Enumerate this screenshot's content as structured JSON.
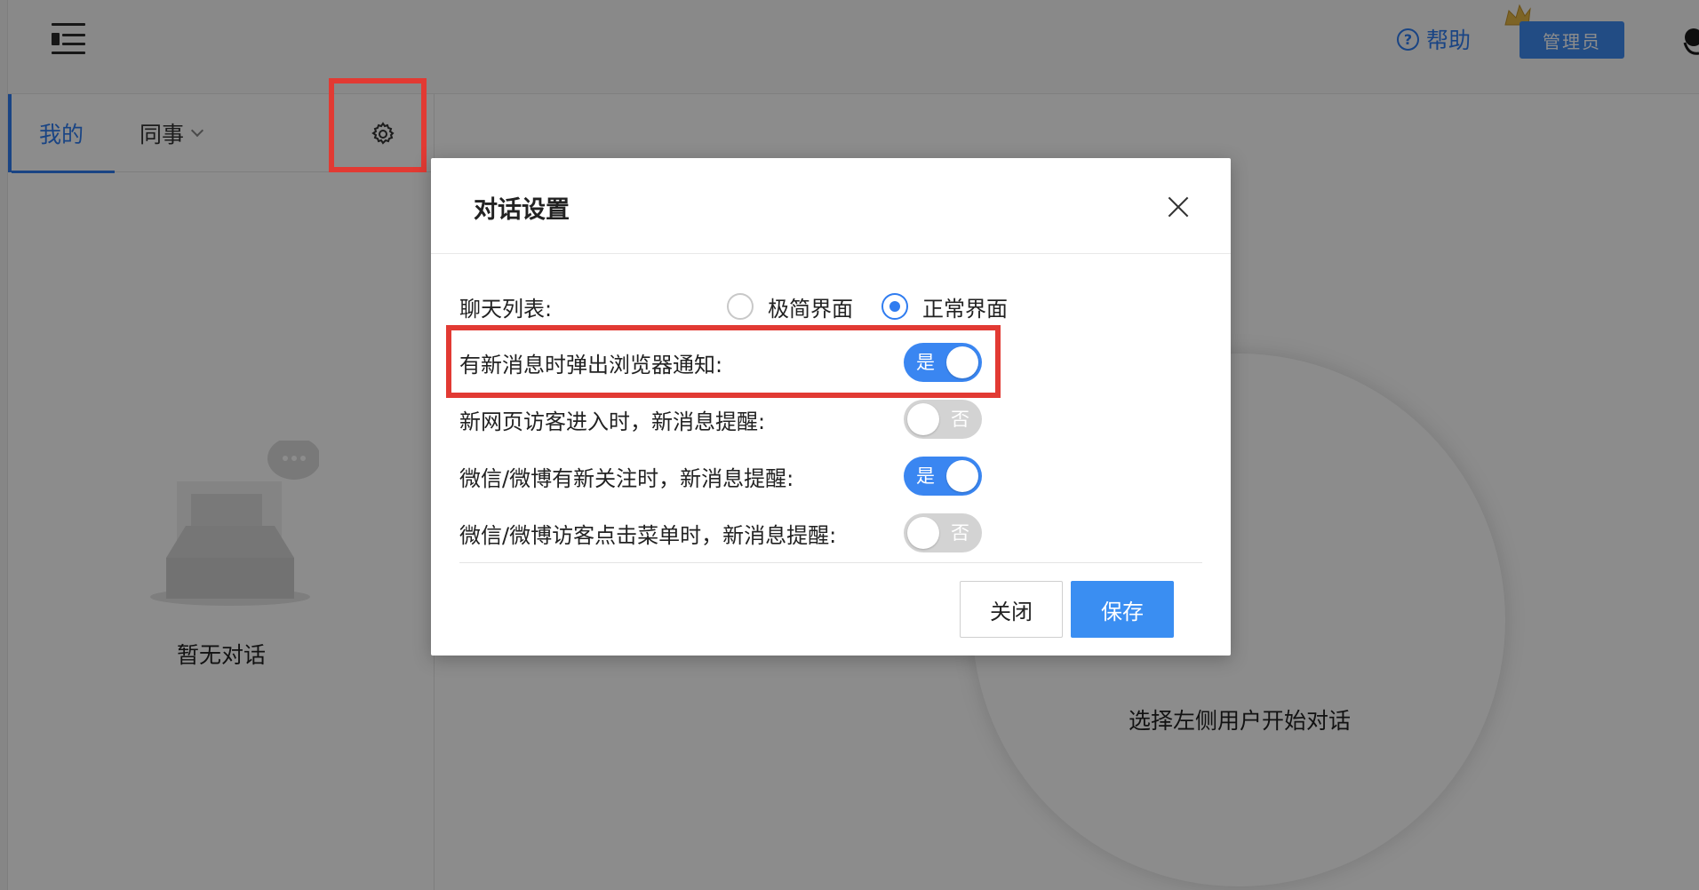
{
  "header": {
    "help_label": "帮助",
    "help_icon_glyph": "?",
    "admin_label": "管理员"
  },
  "sidebar": {
    "tabs": [
      {
        "label": "我的",
        "active": true
      },
      {
        "label": "同事",
        "active": false
      }
    ],
    "empty_text": "暂无对话"
  },
  "main": {
    "empty_text": "选择左侧用户开始对话"
  },
  "dialog": {
    "title": "对话设置",
    "chat_list": {
      "label": "聊天列表:",
      "options": [
        {
          "label": "极简界面",
          "selected": false
        },
        {
          "label": "正常界面",
          "selected": true
        }
      ]
    },
    "settings": [
      {
        "label": "有新消息时弹出浏览器通知:",
        "state_label": "是",
        "on": true
      },
      {
        "label": "新网页访客进入时，新消息提醒:",
        "state_label": "否",
        "on": false
      },
      {
        "label": "微信/微博有新关注时，新消息提醒:",
        "state_label": "是",
        "on": true
      },
      {
        "label": "微信/微博访客点击菜单时，新消息提醒:",
        "state_label": "否",
        "on": false
      }
    ],
    "close_button": "关闭",
    "save_button": "保存"
  },
  "colors": {
    "accent": "#2f7cf0",
    "highlight": "#e23a33",
    "switch_off": "#d3d3d3"
  }
}
